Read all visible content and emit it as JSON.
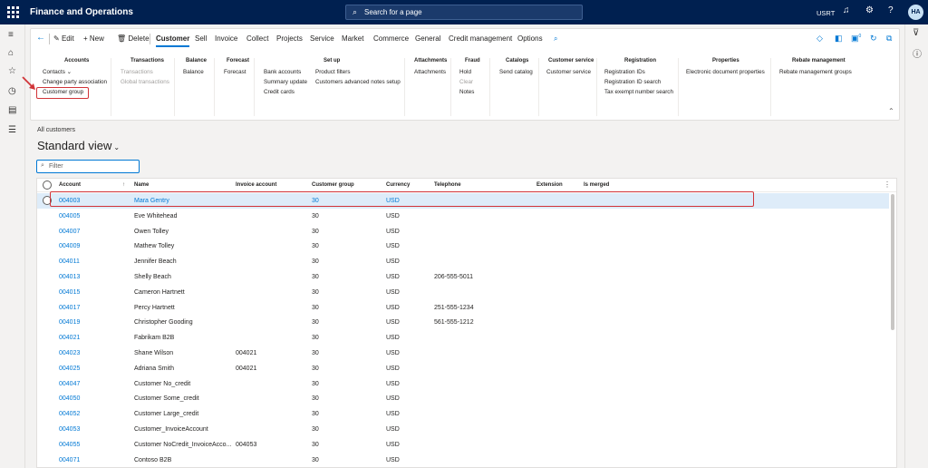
{
  "topbar": {
    "app_title": "Finance and Operations",
    "search_placeholder": "Search for a page",
    "company": "USRT",
    "avatar_initials": "HA",
    "icons": [
      "waffle-icon",
      "bell-icon",
      "gear-icon",
      "help-icon"
    ]
  },
  "leftnav": {
    "icons": [
      "hamburger-icon",
      "home-icon",
      "star-icon",
      "recent-icon",
      "workspace-icon",
      "list-icon"
    ]
  },
  "rightrail": {
    "icons": [
      "filter-icon",
      "info-icon"
    ]
  },
  "actionbar": {
    "back": "←",
    "edit": "Edit",
    "new": "New",
    "delete": "Delete",
    "tabs": [
      "Customer",
      "Sell",
      "Invoice",
      "Collect",
      "Projects",
      "Service",
      "Market",
      "Commerce",
      "General",
      "Credit management",
      "Options"
    ],
    "selected_tab": "Customer",
    "notification_count": "0"
  },
  "ribbon": {
    "groups": [
      {
        "title": "Accounts",
        "items": [
          "Contacts ⌄",
          "Change party association",
          "Customer group"
        ]
      },
      {
        "title": "Transactions",
        "items": [
          "Transactions",
          "Global transactions"
        ]
      },
      {
        "title": "Balance",
        "items": [
          "Balance"
        ]
      },
      {
        "title": "Forecast",
        "items": [
          "Forecast"
        ]
      },
      {
        "title": "Set up",
        "items": [
          "Bank accounts",
          "Summary update",
          "Credit cards",
          "Product filters",
          "Customers advanced notes setup"
        ]
      },
      {
        "title": "Attachments",
        "items": [
          "Attachments"
        ]
      },
      {
        "title": "Fraud",
        "items": [
          "Hold",
          "Clear",
          "Notes"
        ]
      },
      {
        "title": "Catalogs",
        "items": [
          "Send catalog"
        ]
      },
      {
        "title": "Customer service",
        "items": [
          "Customer service"
        ]
      },
      {
        "title": "Registration",
        "items": [
          "Registration IDs",
          "Registration ID search",
          "Tax exempt number search"
        ]
      },
      {
        "title": "Properties",
        "items": [
          "Electronic document properties"
        ]
      },
      {
        "title": "Rebate management",
        "items": [
          "Rebate management groups"
        ]
      }
    ]
  },
  "page": {
    "breadcrumb": "All customers",
    "view_title": "Standard view",
    "filter_placeholder": "Filter"
  },
  "grid": {
    "columns": [
      "Account",
      "Name",
      "Invoice account",
      "Customer group",
      "Currency",
      "Telephone",
      "Extension",
      "Is merged"
    ],
    "rows": [
      [
        "004003",
        "Mara Gentry",
        "",
        "30",
        "USD",
        "",
        "",
        ""
      ],
      [
        "004005",
        "Eve Whitehead",
        "",
        "30",
        "USD",
        "",
        "",
        ""
      ],
      [
        "004007",
        "Owen  Tolley",
        "",
        "30",
        "USD",
        "",
        "",
        ""
      ],
      [
        "004009",
        "Mathew Tolley",
        "",
        "30",
        "USD",
        "",
        "",
        ""
      ],
      [
        "004011",
        "Jennifer Beach",
        "",
        "30",
        "USD",
        "",
        "",
        ""
      ],
      [
        "004013",
        "Shelly Beach",
        "",
        "30",
        "USD",
        "206-555-5011",
        "",
        ""
      ],
      [
        "004015",
        "Cameron Hartnett",
        "",
        "30",
        "USD",
        "",
        "",
        ""
      ],
      [
        "004017",
        "Percy Hartnett",
        "",
        "30",
        "USD",
        "251-555-1234",
        "",
        ""
      ],
      [
        "004019",
        "Christopher Gooding",
        "",
        "30",
        "USD",
        "561-555-1212",
        "",
        ""
      ],
      [
        "004021",
        "Fabrikam B2B",
        "",
        "30",
        "USD",
        "",
        "",
        ""
      ],
      [
        "004023",
        "Shane Wilson",
        "004021",
        "30",
        "USD",
        "",
        "",
        ""
      ],
      [
        "004025",
        "Adriana Smith",
        "004021",
        "30",
        "USD",
        "",
        "",
        ""
      ],
      [
        "004047",
        "Customer No_credit",
        "",
        "30",
        "USD",
        "",
        "",
        ""
      ],
      [
        "004050",
        "Customer Some_credit",
        "",
        "30",
        "USD",
        "",
        "",
        ""
      ],
      [
        "004052",
        "Customer Large_credit",
        "",
        "30",
        "USD",
        "",
        "",
        ""
      ],
      [
        "004053",
        "Customer_InvoiceAccount",
        "",
        "30",
        "USD",
        "",
        "",
        ""
      ],
      [
        "004055",
        "Customer NoCredit_InvoiceAcco...",
        "004053",
        "30",
        "USD",
        "",
        "",
        ""
      ],
      [
        "004071",
        "Contoso B2B",
        "",
        "30",
        "USD",
        "",
        "",
        ""
      ]
    ],
    "selected_row": 0
  },
  "colors": {
    "topbar": "#002050",
    "accent": "#0078d4",
    "highlight": "#d13438",
    "selected_row": "#deecf9"
  }
}
